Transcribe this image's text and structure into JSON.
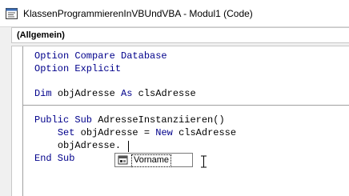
{
  "window": {
    "title": "KlassenProgrammierenInVBUndVBA - Modul1 (Code)"
  },
  "object_combo": {
    "value": "(Allgemein)"
  },
  "code": {
    "line1": {
      "kw": "Option Compare Database"
    },
    "line2": {
      "kw": "Option Explicit"
    },
    "line3": {
      "kw1": "Dim ",
      "tx1": "objAdresse ",
      "kw2": "As ",
      "tx2": "clsAdresse"
    },
    "line4": {
      "kw": "Public Sub ",
      "tx": "AdresseInstanziieren()"
    },
    "line5": {
      "indent": "    ",
      "kw1": "Set ",
      "tx1": "objAdresse = ",
      "kw2": "New ",
      "tx2": "clsAdresse"
    },
    "line6": {
      "indent": "    ",
      "tx": "objAdresse."
    },
    "line7": {
      "kw": "End Sub"
    }
  },
  "autocomplete": {
    "items": [
      "Vorname"
    ],
    "icon": "property-icon"
  },
  "colors": {
    "keyword": "#00008b",
    "text": "#000000"
  }
}
